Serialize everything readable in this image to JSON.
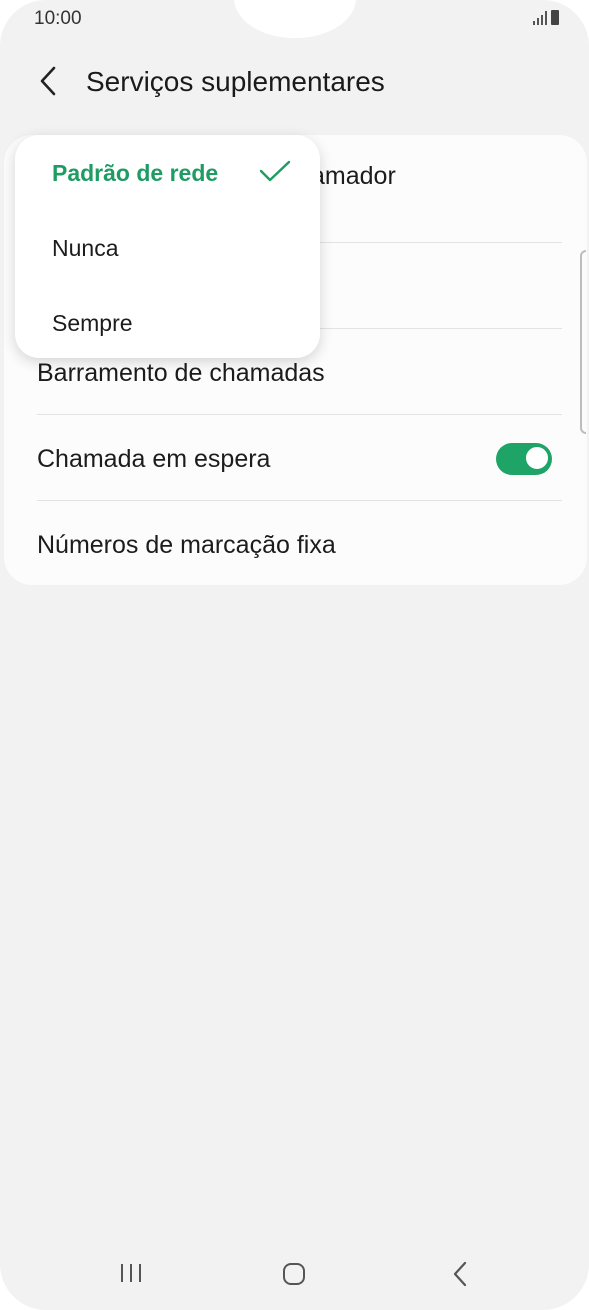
{
  "status_bar": {
    "time": "10:00"
  },
  "header": {
    "title": "Serviços suplementares"
  },
  "settings": {
    "items": [
      {
        "label": "Mostrar identificação do chamador",
        "visible_fragment": "amador"
      },
      {
        "label": ""
      },
      {
        "label": "Barramento de chamadas"
      },
      {
        "label": "Chamada em espera",
        "toggle": true
      },
      {
        "label": "Números de marcação fixa"
      }
    ]
  },
  "dropdown": {
    "options": [
      "Padrão de rede",
      "Nunca",
      "Sempre"
    ],
    "selected": "Padrão de rede"
  },
  "colors": {
    "accent": "#1e9c63",
    "toggle_on": "#1ea466",
    "background": "#f2f2f2"
  }
}
